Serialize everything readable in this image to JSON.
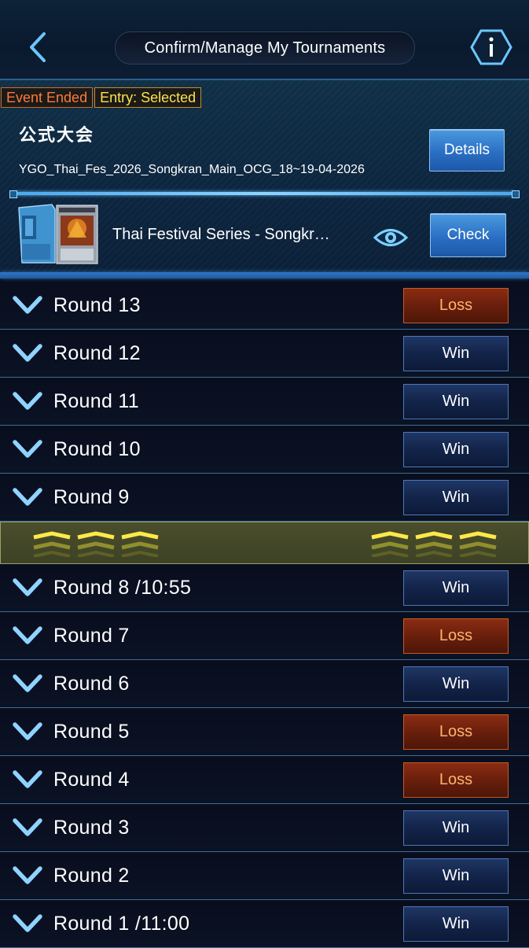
{
  "header": {
    "title": "Confirm/Manage My Tournaments"
  },
  "event": {
    "status_badge": "Event Ended",
    "entry_badge": "Entry: Selected",
    "name": "公式大会",
    "id": "YGO_Thai_Fes_2026_Songkran_Main_OCG_18~19-04-2026",
    "details_label": "Details",
    "deck_name": "Thai Festival Series - Songkr…",
    "check_label": "Check"
  },
  "rounds_before": [
    {
      "label": "Round 13",
      "result": "Loss"
    },
    {
      "label": "Round 12",
      "result": "Win"
    },
    {
      "label": "Round 11",
      "result": "Win"
    },
    {
      "label": "Round 10",
      "result": "Win"
    },
    {
      "label": "Round 9",
      "result": "Win"
    }
  ],
  "rounds_after": [
    {
      "label": "Round 8  /10:55",
      "result": "Win"
    },
    {
      "label": "Round 7",
      "result": "Loss"
    },
    {
      "label": "Round 6",
      "result": "Win"
    },
    {
      "label": "Round 5",
      "result": "Loss"
    },
    {
      "label": "Round 4",
      "result": "Loss"
    },
    {
      "label": "Round 3",
      "result": "Win"
    },
    {
      "label": "Round 2",
      "result": "Win"
    },
    {
      "label": "Round 1  /11:00",
      "result": "Win"
    }
  ],
  "colors": {
    "win_bg": "#13244a",
    "loss_bg": "#6a1f0c",
    "loss_text": "#ffb36b",
    "ended_badge": "#ff7a3a",
    "entry_badge": "#ffe14a",
    "separator_band": "#4a4e2c"
  },
  "icons": [
    "back-arrow-icon",
    "info-icon",
    "deck-box-icon",
    "card-icon",
    "eye-icon",
    "chevron-down-icon",
    "double-chevron-up-icon"
  ]
}
